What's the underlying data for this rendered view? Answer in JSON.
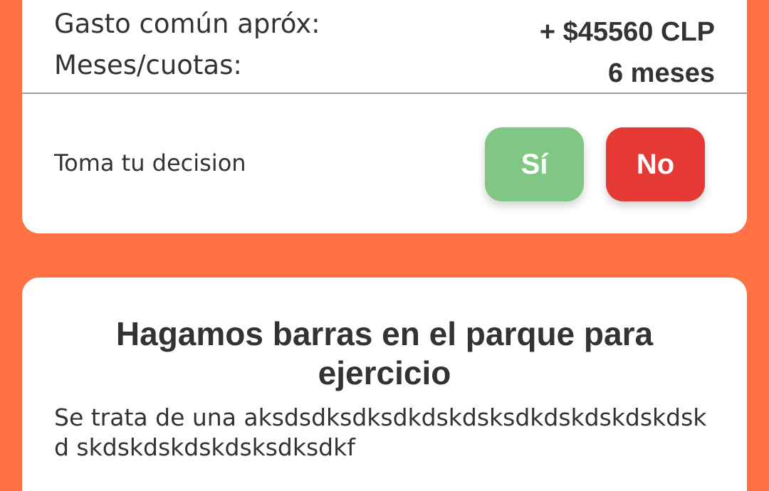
{
  "offer_card": {
    "rows": [
      {
        "label": "Gasto común apróx:",
        "value": "+ $45560 CLP"
      },
      {
        "label": "Meses/cuotas:",
        "value": "6 meses"
      }
    ],
    "decision_label": "Toma tu decision",
    "yes_label": "Sí",
    "no_label": "No"
  },
  "activity_card": {
    "title": "Hagamos barras en el parque para ejercicio",
    "description": "Se trata de una aksdsdksdksdkdskdsksdkdskdskdskdskd skdskdskdskdsksdksdkf"
  },
  "colors": {
    "background": "#FF7043",
    "card": "#FFFFFF",
    "yes_button": "#81C784",
    "no_button": "#E53935",
    "text": "#333333",
    "divider": "#9E9E9E"
  }
}
